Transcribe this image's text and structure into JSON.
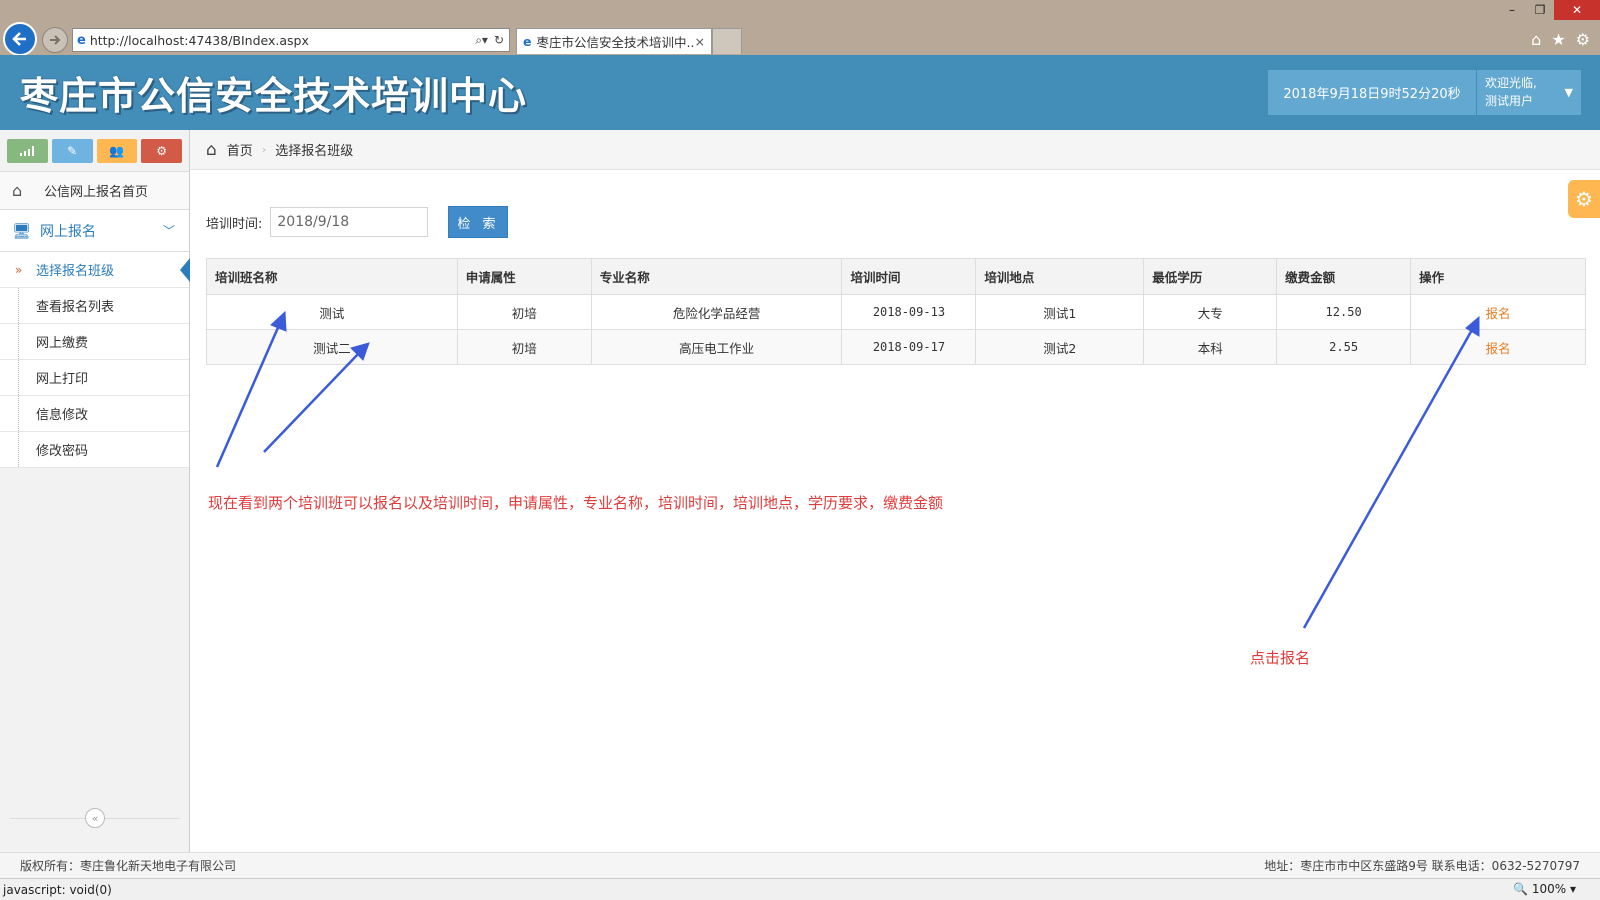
{
  "browser": {
    "url": "http://localhost:47438/BIndex.aspx",
    "tab_title": "枣庄市公信安全技术培训中...",
    "status_text": "javascript: void(0)",
    "zoom": "100%"
  },
  "header": {
    "logo": "枣庄市公信安全技术培训中心",
    "datetime": "2018年9月18日9时52分20秒",
    "welcome": "欢迎光临,",
    "username": "测试用户"
  },
  "colors": {
    "header": "#438eb9",
    "shortcut_green": "#87b87f",
    "shortcut_blue": "#6fb3e0",
    "shortcut_orange": "#ffb752",
    "shortcut_red": "#d15b47",
    "annotation": "#e23b3b",
    "arrow": "#3b5bd9"
  },
  "sidebar": {
    "home": "公信网上报名首页",
    "group": "网上报名",
    "items": [
      {
        "label": "选择报名班级",
        "active": true
      },
      {
        "label": "查看报名列表"
      },
      {
        "label": "网上缴费"
      },
      {
        "label": "网上打印"
      },
      {
        "label": "信息修改"
      },
      {
        "label": "修改密码"
      }
    ]
  },
  "breadcrumb": {
    "home": "首页",
    "current": "选择报名班级"
  },
  "search": {
    "label": "培训时间:",
    "value": "2018/9/18",
    "button": "检 索"
  },
  "table": {
    "headers": [
      "培训班名称",
      "申请属性",
      "专业名称",
      "培训时间",
      "培训地点",
      "最低学历",
      "缴费金额",
      "操作"
    ],
    "rows": [
      [
        "测试",
        "初培",
        "危险化学品经营",
        "2018-09-13",
        "测试1",
        "大专",
        "12.50",
        "报名"
      ],
      [
        "测试二",
        "初培",
        "高压电工作业",
        "2018-09-17",
        "测试2",
        "本科",
        "2.55",
        "报名"
      ]
    ]
  },
  "annotations": {
    "note1": "现在看到两个培训班可以报名以及培训时间，申请属性，专业名称，培训时间，培训地点，学历要求，缴费金额",
    "note2": "点击报名"
  },
  "footer": {
    "copyright": "版权所有：枣庄鲁化新天地电子有限公司",
    "contact": "地址：枣庄市市中区东盛路9号 联系电话：0632-5270797"
  }
}
